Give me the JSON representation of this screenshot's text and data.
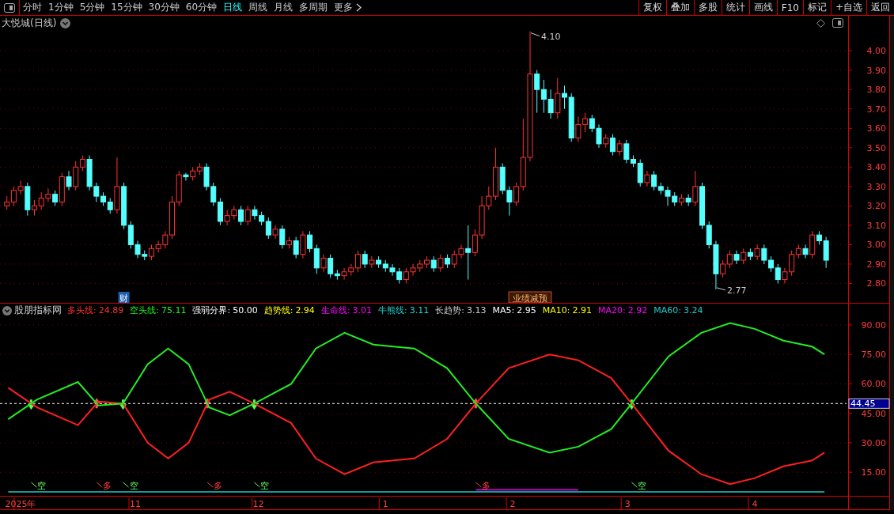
{
  "toolbar": {
    "periods": [
      {
        "label": "分时",
        "selected": false
      },
      {
        "label": "1分钟",
        "selected": false
      },
      {
        "label": "5分钟",
        "selected": false
      },
      {
        "label": "15分钟",
        "selected": false
      },
      {
        "label": "30分钟",
        "selected": false
      },
      {
        "label": "60分钟",
        "selected": false
      },
      {
        "label": "日线",
        "selected": true
      },
      {
        "label": "周线",
        "selected": false
      },
      {
        "label": "月线",
        "selected": false
      },
      {
        "label": "多周期",
        "selected": false
      }
    ],
    "more": "更多",
    "buttons": [
      "复权",
      "叠加",
      "多股",
      "统计",
      "画线",
      "F10",
      "标记",
      "+自选",
      "返回"
    ]
  },
  "price_panel": {
    "title": "大悦城(日线)",
    "chart_data": {
      "type": "candlestick",
      "grid": true,
      "ylim": [
        2.7,
        4.18
      ],
      "yticks": [
        {
          "value": 2.8,
          "label": "2.80"
        },
        {
          "value": 2.9,
          "label": "2.90"
        },
        {
          "value": 3.0,
          "label": "3.00"
        },
        {
          "value": 3.1,
          "label": "3.10"
        },
        {
          "value": 3.2,
          "label": "3.20"
        },
        {
          "value": 3.3,
          "label": "3.30"
        },
        {
          "value": 3.4,
          "label": "3.40"
        },
        {
          "value": 3.5,
          "label": "3.50"
        },
        {
          "value": 3.6,
          "label": "3.60"
        },
        {
          "value": 3.7,
          "label": "3.70"
        },
        {
          "value": 3.8,
          "label": "3.80"
        },
        {
          "value": 3.9,
          "label": "3.90"
        },
        {
          "value": 4.0,
          "label": "4.00"
        }
      ],
      "categories": [
        null,
        null,
        null,
        null,
        null,
        null,
        null,
        null,
        null,
        null,
        null,
        null,
        null,
        null,
        null,
        null,
        null,
        null,
        null,
        null,
        null,
        null,
        null,
        null,
        null,
        null,
        null,
        null,
        null,
        null,
        null,
        null,
        null,
        null,
        null,
        null,
        null,
        null,
        null,
        null,
        null,
        null,
        null,
        null,
        null,
        null,
        null,
        null,
        null,
        null,
        null,
        null,
        null,
        null,
        null,
        null,
        null,
        null,
        null,
        null,
        null,
        null,
        null,
        null,
        null,
        null,
        null,
        null,
        null,
        null,
        null,
        null,
        null,
        null,
        null,
        null,
        null,
        null,
        null,
        null,
        null,
        null,
        null,
        null,
        null,
        null,
        null,
        null,
        null,
        null,
        null,
        null,
        null,
        null,
        null,
        null,
        null,
        null,
        null,
        null,
        null,
        null,
        null,
        null,
        null,
        null,
        null,
        null,
        null,
        null,
        null,
        null,
        null,
        null,
        null,
        null,
        null,
        null,
        null,
        null
      ],
      "ohlc": [
        [
          3.2,
          3.25,
          3.18,
          3.22
        ],
        [
          3.22,
          3.3,
          3.2,
          3.28
        ],
        [
          3.28,
          3.33,
          3.26,
          3.3
        ],
        [
          3.3,
          3.32,
          3.15,
          3.18
        ],
        [
          3.18,
          3.23,
          3.15,
          3.2
        ],
        [
          3.2,
          3.27,
          3.18,
          3.24
        ],
        [
          3.24,
          3.29,
          3.22,
          3.26
        ],
        [
          3.26,
          3.28,
          3.2,
          3.22
        ],
        [
          3.22,
          3.37,
          3.2,
          3.35
        ],
        [
          3.35,
          3.38,
          3.28,
          3.3
        ],
        [
          3.3,
          3.43,
          3.28,
          3.4
        ],
        [
          3.4,
          3.46,
          3.38,
          3.44
        ],
        [
          3.44,
          3.46,
          3.28,
          3.3
        ],
        [
          3.3,
          3.32,
          3.22,
          3.25
        ],
        [
          3.25,
          3.27,
          3.2,
          3.22
        ],
        [
          3.22,
          3.24,
          3.16,
          3.18
        ],
        [
          3.18,
          3.45,
          3.16,
          3.3
        ],
        [
          3.3,
          3.32,
          3.08,
          3.1
        ],
        [
          3.1,
          3.12,
          2.98,
          3.0
        ],
        [
          3.0,
          3.02,
          2.93,
          2.95
        ],
        [
          2.95,
          2.97,
          2.92,
          2.94
        ],
        [
          2.94,
          3.0,
          2.92,
          2.98
        ],
        [
          2.98,
          3.02,
          2.96,
          3.0
        ],
        [
          3.0,
          3.07,
          2.98,
          3.05
        ],
        [
          3.05,
          3.25,
          3.03,
          3.22
        ],
        [
          3.22,
          3.38,
          3.2,
          3.36
        ],
        [
          3.36,
          3.37,
          3.33,
          3.35
        ],
        [
          3.35,
          3.4,
          3.33,
          3.38
        ],
        [
          3.38,
          3.42,
          3.36,
          3.4
        ],
        [
          3.4,
          3.42,
          3.28,
          3.3
        ],
        [
          3.3,
          3.32,
          3.2,
          3.22
        ],
        [
          3.22,
          3.24,
          3.1,
          3.12
        ],
        [
          3.12,
          3.18,
          3.1,
          3.15
        ],
        [
          3.15,
          3.2,
          3.13,
          3.18
        ],
        [
          3.18,
          3.2,
          3.1,
          3.12
        ],
        [
          3.12,
          3.2,
          3.1,
          3.18
        ],
        [
          3.18,
          3.2,
          3.13,
          3.15
        ],
        [
          3.15,
          3.17,
          3.1,
          3.12
        ],
        [
          3.12,
          3.14,
          3.03,
          3.05
        ],
        [
          3.05,
          3.1,
          3.03,
          3.08
        ],
        [
          3.08,
          3.1,
          2.98,
          3.0
        ],
        [
          3.0,
          3.04,
          2.98,
          3.02
        ],
        [
          3.02,
          3.04,
          2.93,
          2.95
        ],
        [
          2.95,
          3.07,
          2.93,
          3.05
        ],
        [
          3.05,
          3.07,
          2.96,
          2.98
        ],
        [
          2.98,
          3.0,
          2.85,
          2.88
        ],
        [
          2.88,
          2.95,
          2.86,
          2.93
        ],
        [
          2.93,
          2.95,
          2.83,
          2.85
        ],
        [
          2.85,
          2.87,
          2.82,
          2.84
        ],
        [
          2.84,
          2.88,
          2.82,
          2.86
        ],
        [
          2.86,
          2.9,
          2.84,
          2.88
        ],
        [
          2.88,
          2.97,
          2.86,
          2.95
        ],
        [
          2.95,
          2.97,
          2.88,
          2.9
        ],
        [
          2.9,
          2.94,
          2.88,
          2.92
        ],
        [
          2.92,
          2.94,
          2.88,
          2.9
        ],
        [
          2.9,
          2.92,
          2.86,
          2.88
        ],
        [
          2.88,
          2.9,
          2.84,
          2.86
        ],
        [
          2.86,
          2.88,
          2.8,
          2.82
        ],
        [
          2.82,
          2.88,
          2.8,
          2.86
        ],
        [
          2.86,
          2.9,
          2.84,
          2.88
        ],
        [
          2.88,
          2.92,
          2.86,
          2.9
        ],
        [
          2.9,
          2.94,
          2.88,
          2.92
        ],
        [
          2.92,
          2.94,
          2.86,
          2.88
        ],
        [
          2.88,
          2.95,
          2.86,
          2.93
        ],
        [
          2.93,
          2.95,
          2.88,
          2.9
        ],
        [
          2.9,
          2.97,
          2.88,
          2.95
        ],
        [
          2.95,
          3.0,
          2.93,
          2.98
        ],
        [
          2.98,
          3.1,
          2.82,
          2.96
        ],
        [
          2.96,
          3.08,
          2.94,
          3.05
        ],
        [
          3.05,
          3.25,
          3.03,
          3.2
        ],
        [
          3.2,
          3.3,
          3.18,
          3.25
        ],
        [
          3.25,
          3.5,
          3.23,
          3.4
        ],
        [
          3.4,
          3.42,
          3.26,
          3.28
        ],
        [
          3.28,
          3.3,
          3.15,
          3.22
        ],
        [
          3.22,
          3.32,
          3.2,
          3.3
        ],
        [
          3.3,
          3.65,
          3.28,
          3.45
        ],
        [
          3.45,
          4.1,
          3.43,
          3.88
        ],
        [
          3.88,
          3.9,
          3.68,
          3.8
        ],
        [
          3.8,
          3.85,
          3.68,
          3.75
        ],
        [
          3.75,
          3.8,
          3.65,
          3.68
        ],
        [
          3.68,
          3.86,
          3.65,
          3.78
        ],
        [
          3.78,
          3.82,
          3.7,
          3.76
        ],
        [
          3.76,
          3.78,
          3.53,
          3.55
        ],
        [
          3.55,
          3.66,
          3.53,
          3.62
        ],
        [
          3.62,
          3.68,
          3.58,
          3.65
        ],
        [
          3.65,
          3.67,
          3.58,
          3.6
        ],
        [
          3.6,
          3.62,
          3.5,
          3.52
        ],
        [
          3.52,
          3.57,
          3.5,
          3.55
        ],
        [
          3.55,
          3.57,
          3.46,
          3.48
        ],
        [
          3.48,
          3.54,
          3.46,
          3.52
        ],
        [
          3.52,
          3.54,
          3.42,
          3.44
        ],
        [
          3.44,
          3.46,
          3.4,
          3.42
        ],
        [
          3.42,
          3.44,
          3.3,
          3.32
        ],
        [
          3.32,
          3.38,
          3.3,
          3.36
        ],
        [
          3.36,
          3.38,
          3.28,
          3.3
        ],
        [
          3.3,
          3.32,
          3.26,
          3.28
        ],
        [
          3.28,
          3.3,
          3.2,
          3.25
        ],
        [
          3.25,
          3.27,
          3.2,
          3.22
        ],
        [
          3.22,
          3.26,
          3.2,
          3.24
        ],
        [
          3.24,
          3.26,
          3.2,
          3.22
        ],
        [
          3.22,
          3.38,
          3.2,
          3.3
        ],
        [
          3.3,
          3.32,
          3.08,
          3.1
        ],
        [
          3.1,
          3.12,
          2.98,
          3.0
        ],
        [
          3.0,
          3.02,
          2.77,
          2.85
        ],
        [
          2.85,
          2.92,
          2.83,
          2.9
        ],
        [
          2.9,
          2.97,
          2.88,
          2.95
        ],
        [
          2.95,
          2.97,
          2.9,
          2.92
        ],
        [
          2.92,
          2.98,
          2.9,
          2.96
        ],
        [
          2.96,
          2.98,
          2.92,
          2.94
        ],
        [
          2.94,
          3.0,
          2.92,
          2.98
        ],
        [
          2.98,
          3.0,
          2.9,
          2.92
        ],
        [
          2.92,
          2.94,
          2.86,
          2.88
        ],
        [
          2.88,
          2.9,
          2.8,
          2.82
        ],
        [
          2.82,
          2.88,
          2.8,
          2.86
        ],
        [
          2.86,
          2.97,
          2.84,
          2.95
        ],
        [
          2.95,
          3.0,
          2.93,
          2.98
        ],
        [
          2.98,
          3.0,
          2.93,
          2.95
        ],
        [
          2.95,
          3.07,
          2.93,
          3.05
        ],
        [
          3.05,
          3.07,
          3.0,
          3.02
        ],
        [
          3.02,
          3.04,
          2.88,
          2.92
        ]
      ],
      "annotations": [
        "4.10",
        "2.77",
        "财",
        "业绩减预"
      ]
    }
  },
  "indicator_panel": {
    "title": "股朋指标网",
    "legend": [
      {
        "label": "多头线:",
        "value": "24.89",
        "color": "#ff3232"
      },
      {
        "label": "空头线:",
        "value": "75.11",
        "color": "#22ee22"
      },
      {
        "label": "强弱分界:",
        "value": "50.00",
        "color": "#ffffff"
      },
      {
        "label": "趋势线:",
        "value": "2.94",
        "color": "#ffff00"
      },
      {
        "label": "生命线:",
        "value": "3.01",
        "color": "#ff00ff"
      },
      {
        "label": "牛熊线:",
        "value": "3.11",
        "color": "#22cccc"
      },
      {
        "label": "长趋势:",
        "value": "3.13",
        "color": "#cccccc"
      },
      {
        "label": "MA5:",
        "value": "2.95",
        "color": "#ffffff"
      },
      {
        "label": "MA10:",
        "value": "2.91",
        "color": "#ffff00"
      },
      {
        "label": "MA20:",
        "value": "2.92",
        "color": "#ff00ff"
      },
      {
        "label": "MA60:",
        "value": "3.24",
        "color": "#22cccc"
      }
    ],
    "cursor_value": "44.45",
    "chart_data": {
      "type": "line",
      "grid": true,
      "xlim": [
        "2025-09-29",
        "2026-05-04"
      ],
      "ylim": [
        3,
        94
      ],
      "yticks": [
        {
          "value": 15,
          "label": "15.00"
        },
        {
          "value": 30,
          "label": "30.00"
        },
        {
          "value": 45,
          "label": "45.00"
        },
        {
          "value": 60,
          "label": "60.00"
        },
        {
          "value": 75,
          "label": "75.00"
        },
        {
          "value": 90,
          "label": "90.00"
        }
      ],
      "xticks": [
        {
          "value": "2025-10-04",
          "label": "2025年"
        },
        {
          "value": "2025-11-01",
          "label": "11"
        },
        {
          "value": "2025-12-01",
          "label": "12"
        },
        {
          "value": "2026-01-01",
          "label": "1"
        },
        {
          "value": "2026-02-01",
          "label": "2"
        },
        {
          "value": "2026-03-01",
          "label": "3"
        },
        {
          "value": "2026-04-01",
          "label": "4"
        }
      ],
      "x": [
        "2025-10-01",
        "2025-10-08",
        "2025-10-18",
        "2025-10-23",
        "2025-10-29",
        "2025-11-04",
        "2025-11-09",
        "2025-11-14",
        "2025-11-19",
        "2025-11-24",
        "2025-11-30",
        "2025-12-09",
        "2025-12-15",
        "2025-12-22",
        "2025-12-29",
        "2026-01-08",
        "2026-01-16",
        "2026-01-23",
        "2026-01-31",
        "2026-02-10",
        "2026-02-17",
        "2026-02-25",
        "2026-03-02",
        "2026-03-11",
        "2026-03-19",
        "2026-03-26",
        "2026-04-01",
        "2026-04-08",
        "2026-04-15",
        "2026-04-18"
      ],
      "series": [
        {
          "color": "#ff2020",
          "values": [
            58,
            48,
            39,
            51,
            50,
            30,
            22,
            30,
            52,
            56,
            50,
            40,
            22,
            14,
            20,
            22,
            32,
            50,
            68,
            75,
            72,
            63,
            50,
            26,
            14,
            9,
            12,
            18,
            21,
            25
          ]
        },
        {
          "color": "#22ee22",
          "values": [
            42,
            52,
            61,
            49,
            50,
            70,
            78,
            70,
            48,
            44,
            50,
            60,
            78,
            86,
            80,
            78,
            68,
            50,
            32,
            25,
            28,
            37,
            50,
            74,
            86,
            91,
            88,
            82,
            79,
            75
          ]
        },
        {
          "color": "#22cccc",
          "values": [
            5,
            5,
            5,
            5,
            5,
            5,
            5,
            5,
            5,
            5,
            5,
            5,
            5,
            5,
            5,
            5,
            5,
            5,
            5,
            5,
            5,
            5,
            5,
            5,
            5,
            5,
            5,
            5,
            5,
            5
          ]
        },
        {
          "color": "#ff00ff",
          "values": [
            null,
            null,
            null,
            null,
            null,
            null,
            null,
            null,
            null,
            null,
            null,
            null,
            null,
            null,
            null,
            null,
            null,
            6,
            6,
            6,
            6,
            null,
            null,
            null,
            null,
            null,
            null,
            null,
            null,
            null
          ]
        }
      ],
      "ref_lines": [
        {
          "axis": "y",
          "value": 50
        }
      ],
      "annotations": [
        "空",
        "多",
        "空",
        "多",
        "空",
        "多",
        "空"
      ]
    }
  }
}
